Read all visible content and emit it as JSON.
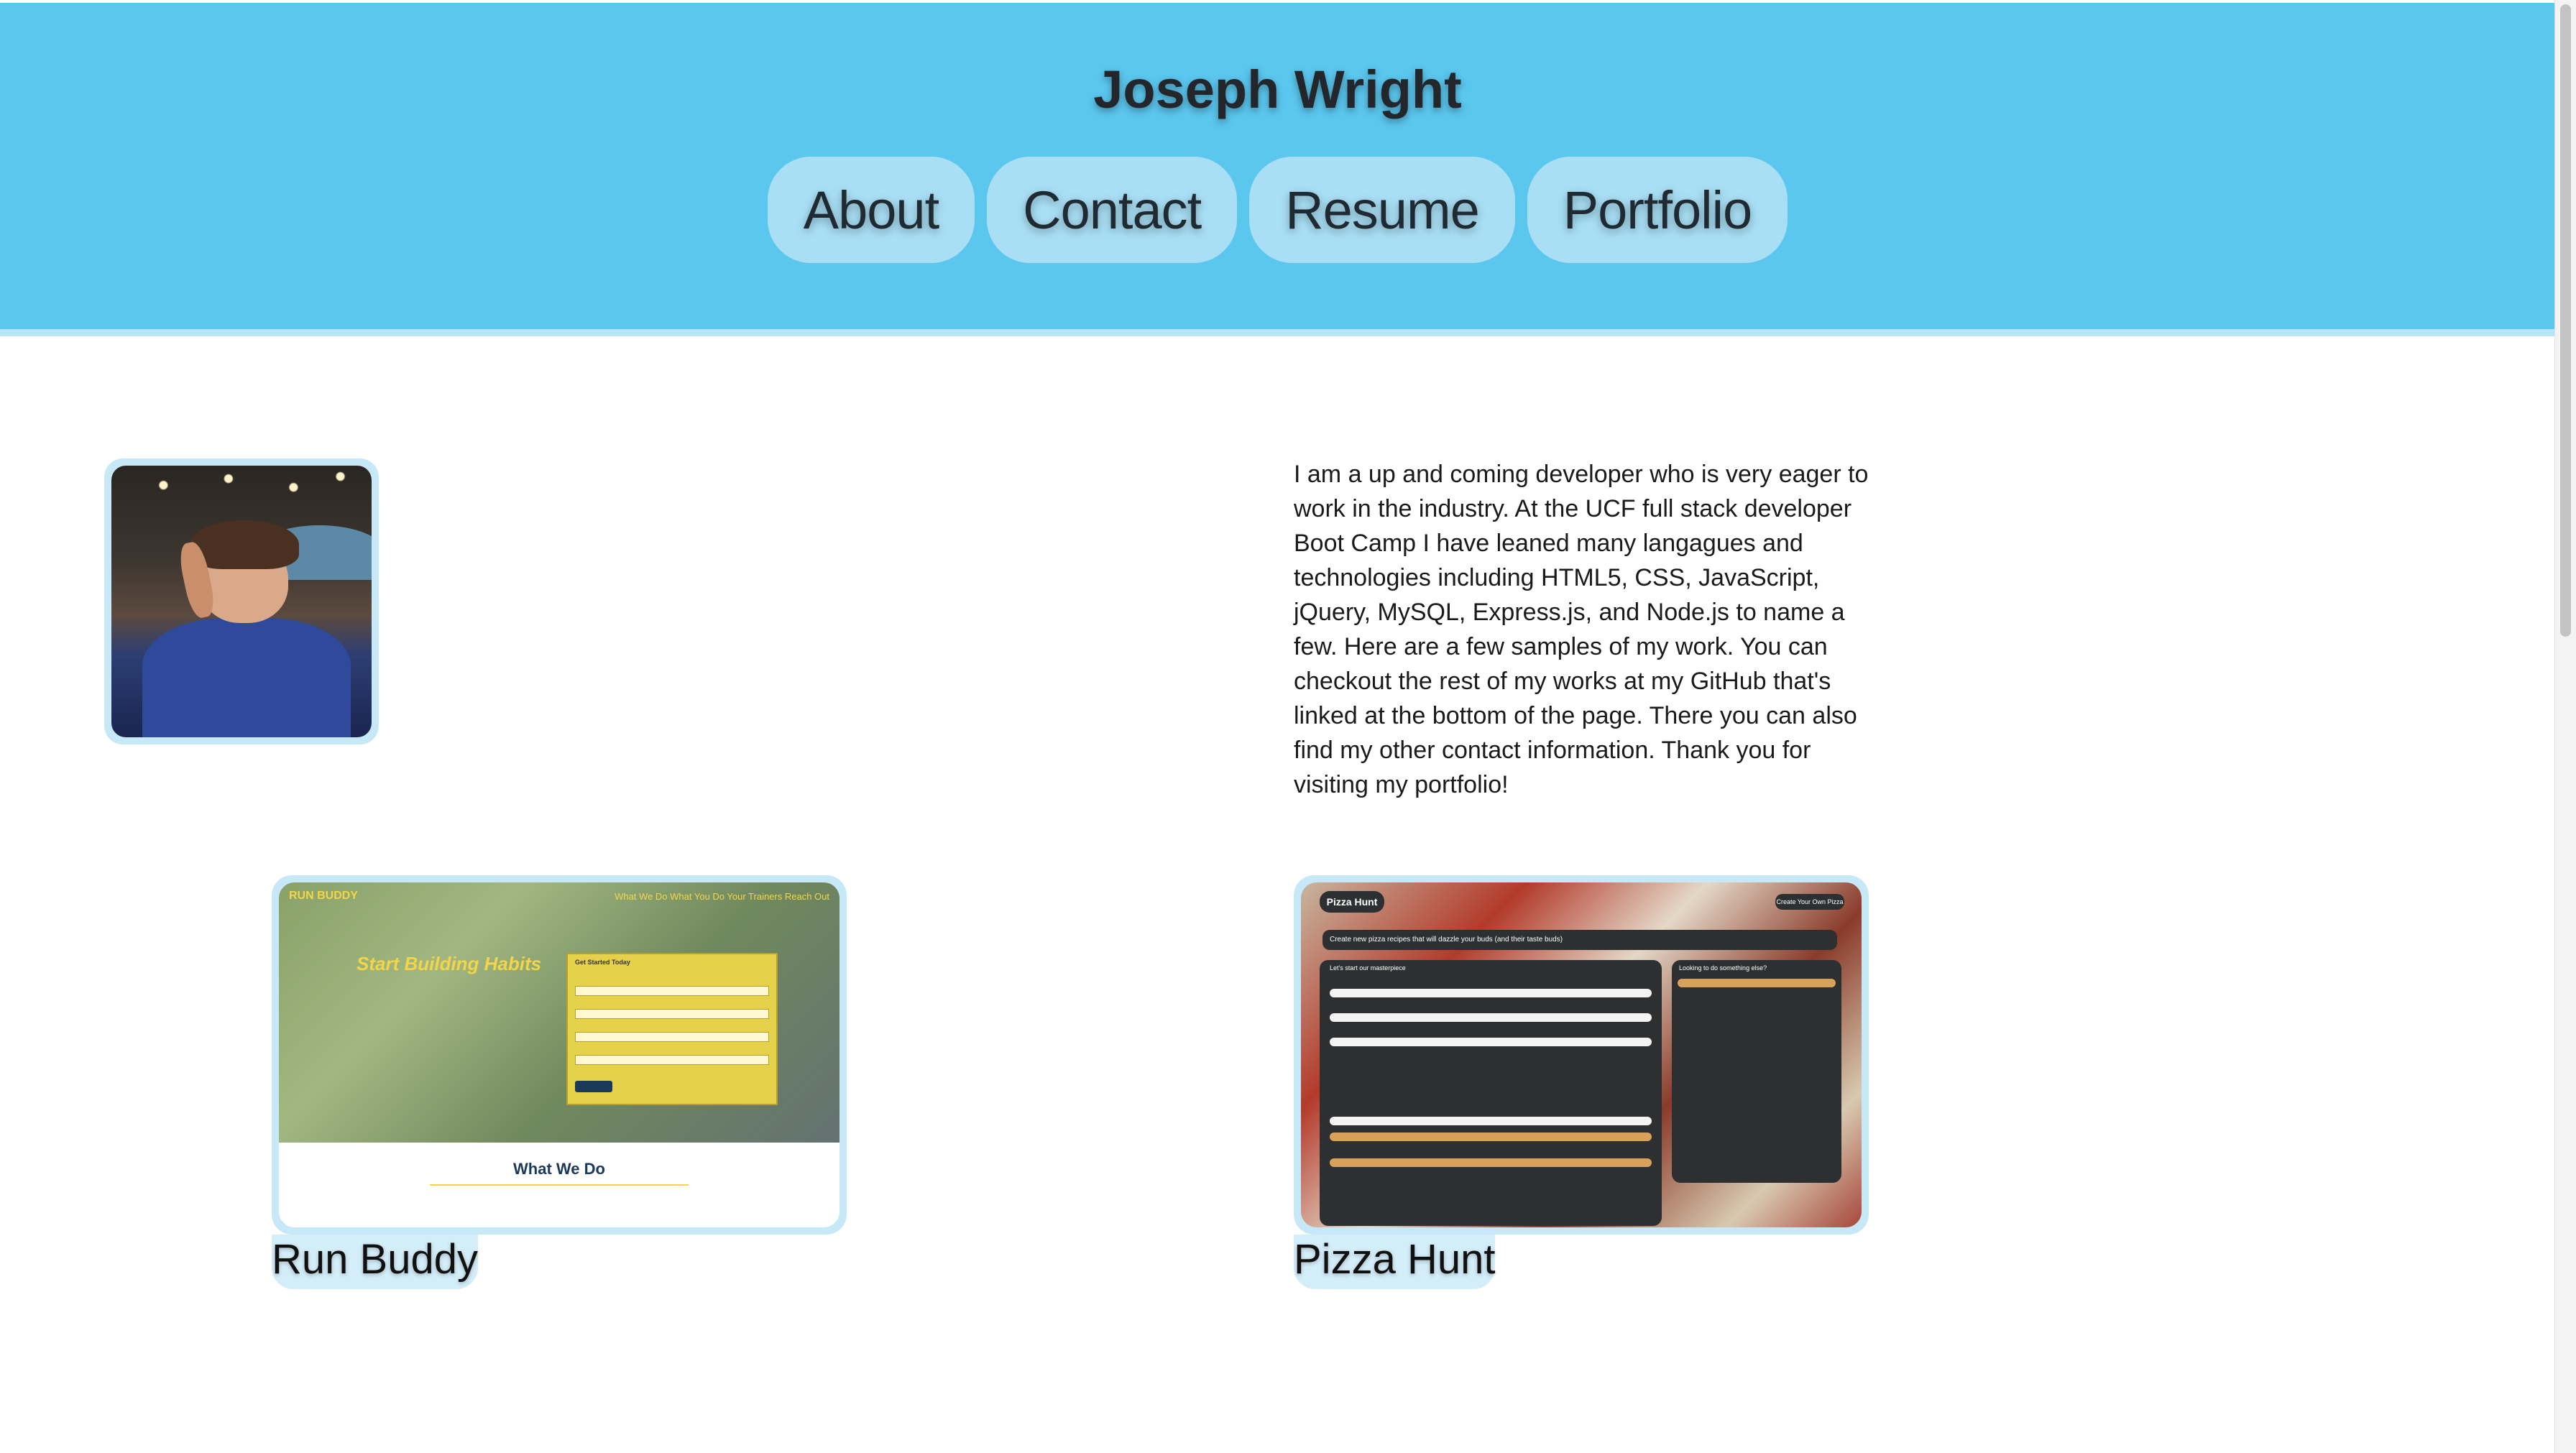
{
  "header": {
    "title": "Joseph Wright",
    "nav": [
      {
        "label": "About"
      },
      {
        "label": "Contact"
      },
      {
        "label": "Resume"
      },
      {
        "label": "Portfolio"
      }
    ]
  },
  "about": {
    "photo_alt": "profile-photo",
    "text": "I am a up and coming developer who is very eager to work in the industry. At the UCF full stack developer Boot Camp I have leaned many langagues and technologies including HTML5, CSS, JavaScript, jQuery, MySQL, Express.js, and Node.js to name a few. Here are a few samples of my work. You can checkout the rest of my works at my GitHub that's linked at the bottom of the page. There you can also find my other contact information. Thank you for visiting my portfolio!"
  },
  "projects": [
    {
      "title": "Run Buddy",
      "preview": {
        "logo": "RUN BUDDY",
        "nav": "What We Do   What You Do   Your Trainers   Reach Out",
        "headline": "Start Building Habits",
        "form_title": "Get Started Today",
        "section": "What We Do"
      }
    },
    {
      "title": "Pizza Hunt",
      "preview": {
        "logo": "Pizza Hunt",
        "button": "Create Your Own Pizza",
        "bar": "Create new pizza recipes that will dazzle your buds (and their taste buds)",
        "left_title": "Let's start our masterpiece",
        "right_title": "Looking to do something else?"
      }
    }
  ],
  "colors": {
    "header_bg": "#5bc6ee",
    "nav_pill_bg": "#a9dff5",
    "frame_bg": "#c7e9f7"
  }
}
